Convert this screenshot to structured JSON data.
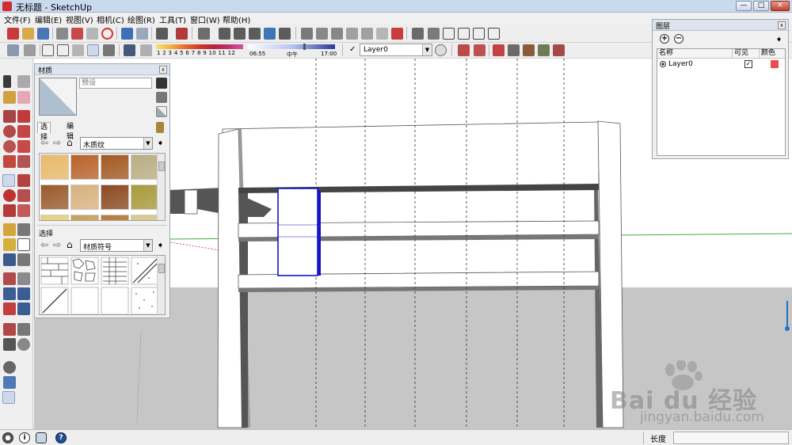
{
  "window": {
    "title": "无标题 - SketchUp",
    "minimize_glyph": "—",
    "maximize_glyph": "□",
    "close_glyph": "✕"
  },
  "menu": {
    "items": [
      {
        "label": "文件(F)"
      },
      {
        "label": "编辑(E)"
      },
      {
        "label": "视图(V)"
      },
      {
        "label": "相机(C)"
      },
      {
        "label": "绘图(R)"
      },
      {
        "label": "工具(T)"
      },
      {
        "label": "窗口(W)"
      },
      {
        "label": "帮助(H)"
      }
    ]
  },
  "toolbar": {
    "shadow_scale_numbers": "1 2 3 4 5 6 7 8 9 10 11 12",
    "time_start": "06:55",
    "time_mid": "中午",
    "time_end": "17:00",
    "current_check_glyph": "✓",
    "layer_select_value": "Layer0",
    "dropdown_glyph": "▼"
  },
  "materials_panel": {
    "title": "材质",
    "close_glyph": "x",
    "name_placeholder": "预设",
    "tabs": [
      {
        "label": "选择"
      },
      {
        "label": "编辑"
      }
    ],
    "library_select_value": "木质纹",
    "second_section_label": "选择",
    "second_select_value": "材质符号",
    "back_glyph": "⇦",
    "forward_glyph": "⇨",
    "home_glyph": "⌂",
    "details_glyph": "➧",
    "dropdown_glyph": "▼",
    "wood_swatches": [
      "#e8b96a",
      "#b8632a",
      "#a35a22",
      "#b9ad83",
      "#9a5b2d",
      "#d8b27f",
      "#8b4a22",
      "#a89a3c",
      "#e5d27a",
      "#c7a15a",
      "#b77a3a",
      "#d6c98f"
    ]
  },
  "layers_panel": {
    "title": "图层",
    "close_glyph": "x",
    "add_glyph": "+",
    "remove_glyph": "−",
    "details_glyph": "➧",
    "columns": [
      {
        "label": "名称"
      },
      {
        "label": "可见"
      },
      {
        "label": "颜色"
      }
    ],
    "rows": [
      {
        "name": "Layer0",
        "visible": true,
        "visible_glyph": "✓",
        "color": "#ef4c4c"
      }
    ]
  },
  "statusbar": {
    "info_glyph": "i",
    "help_glyph": "?",
    "measure_label": "长度",
    "measure_value": ""
  },
  "watermark": {
    "brand": "Bai du 经验",
    "url": "jingyan.baidu.com"
  },
  "colors": {
    "selection": "#1515c8",
    "ground": "#c6c6c6",
    "sky": "#ffffff",
    "axis_green": "#3fae3f",
    "axis_red": "#cc3333"
  }
}
